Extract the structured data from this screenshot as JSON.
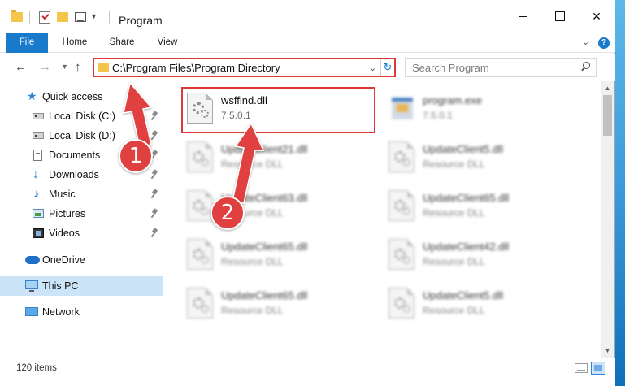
{
  "window": {
    "title": "Program"
  },
  "ribbon": {
    "file": "File",
    "home": "Home",
    "share": "Share",
    "view": "View"
  },
  "address": {
    "path": "C:\\Program Files\\Program Directory"
  },
  "search": {
    "placeholder": "Search Program"
  },
  "nav": {
    "items": [
      {
        "label": "Quick access",
        "icon": "star-icon",
        "pinned": false
      },
      {
        "label": "Local Disk (C:)",
        "icon": "disk-icon",
        "pinned": true
      },
      {
        "label": "Local Disk (D:)",
        "icon": "disk-icon",
        "pinned": true
      },
      {
        "label": "Documents",
        "icon": "documents-icon",
        "pinned": true
      },
      {
        "label": "Downloads",
        "icon": "downloads-icon",
        "pinned": true
      },
      {
        "label": "Music",
        "icon": "music-icon",
        "pinned": true
      },
      {
        "label": "Pictures",
        "icon": "pictures-icon",
        "pinned": true
      },
      {
        "label": "Videos",
        "icon": "videos-icon",
        "pinned": true
      },
      {
        "label": "OneDrive",
        "icon": "onedrive-icon",
        "pinned": false
      },
      {
        "label": "This PC",
        "icon": "this-pc-icon",
        "pinned": false,
        "selected": true
      },
      {
        "label": "Network",
        "icon": "network-icon",
        "pinned": false
      }
    ]
  },
  "files": [
    {
      "name": "wsffind.dll",
      "sub": "7.5.0.1",
      "icon": "dll-icon",
      "highlighted": true
    },
    {
      "name": "program.exe",
      "sub": "7.5.0.1",
      "icon": "exe-icon",
      "blurred": true
    },
    {
      "name": "UpdateClient21.dll",
      "sub": "Resource DLL",
      "icon": "dll-icon",
      "blurred": true
    },
    {
      "name": "UpdateClient5.dll",
      "sub": "Resource DLL",
      "icon": "dll-icon",
      "blurred": true
    },
    {
      "name": "UpdateClient63.dll",
      "sub": "Resource DLL",
      "icon": "dll-icon",
      "blurred": true
    },
    {
      "name": "UpdateClient65.dll",
      "sub": "Resource DLL",
      "icon": "dll-icon",
      "blurred": true
    },
    {
      "name": "UpdateClient65.dll",
      "sub": "Resource DLL",
      "icon": "dll-icon",
      "blurred": true
    },
    {
      "name": "UpdateClient42.dll",
      "sub": "Resource DLL",
      "icon": "dll-icon",
      "blurred": true
    },
    {
      "name": "UpdateClient65.dll",
      "sub": "Resource DLL",
      "icon": "dll-icon",
      "blurred": true
    },
    {
      "name": "UpdateClient5.dll",
      "sub": "Resource DLL",
      "icon": "dll-icon",
      "blurred": true
    }
  ],
  "status": {
    "count": "120 items"
  },
  "annotations": {
    "step1": "1",
    "step2": "2",
    "color": "#e0403f"
  }
}
